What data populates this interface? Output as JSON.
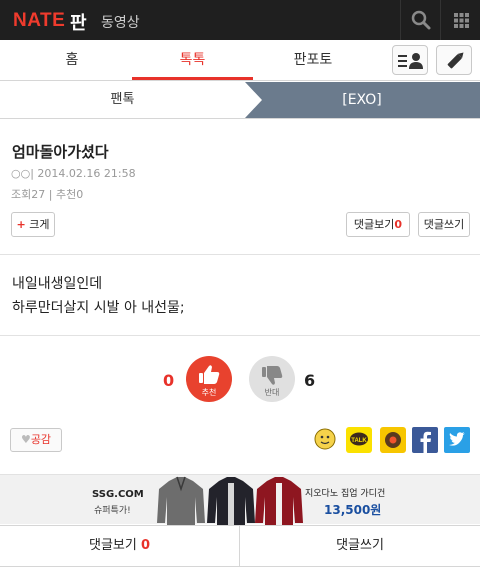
{
  "topbar": {
    "logo": "NATE",
    "pan": "판",
    "video": "동영상"
  },
  "tabs": [
    {
      "label": "홈"
    },
    {
      "label": "톡톡"
    },
    {
      "label": "판포토"
    }
  ],
  "breadcrumb": {
    "left": "팬톡",
    "right": "[EXO]"
  },
  "post": {
    "title": "엄마돌아가셨다",
    "author": "○○|",
    "date": "2014.02.16 21:58",
    "views": "조회27",
    "sep": "|",
    "recommend": "추천0",
    "body_line1": "내일내생일인데",
    "body_line2": "하루만더살지 시발 아 내선물;"
  },
  "buttons": {
    "size_plus": "+",
    "size_label": "크게",
    "comment_view": "댓글보기",
    "comment_count": "0",
    "comment_write": "댓글쓰기",
    "like": "공감"
  },
  "votes": {
    "up_count": "0",
    "up_label": "추천",
    "down_count": "6",
    "down_label": "반대"
  },
  "share_icons": [
    "emoticon-share-icon",
    "kakaotalk-icon",
    "kakaostory-icon",
    "facebook-icon",
    "twitter-icon"
  ],
  "ad": {
    "brand": "SSG.COM",
    "sub": "슈퍼특가!",
    "copy": "지오다노 집업 가디건",
    "price": "13,500원"
  },
  "bottombar": {
    "comment_view": "댓글보기",
    "comment_count": "0",
    "comment_write": "댓글쓰기"
  },
  "colors": {
    "accent": "#e8322a",
    "topbar": "#1f1f1f",
    "crumb_active": "#6b7b8d",
    "facebook": "#3b5998",
    "twitter": "#2aa0e6"
  }
}
